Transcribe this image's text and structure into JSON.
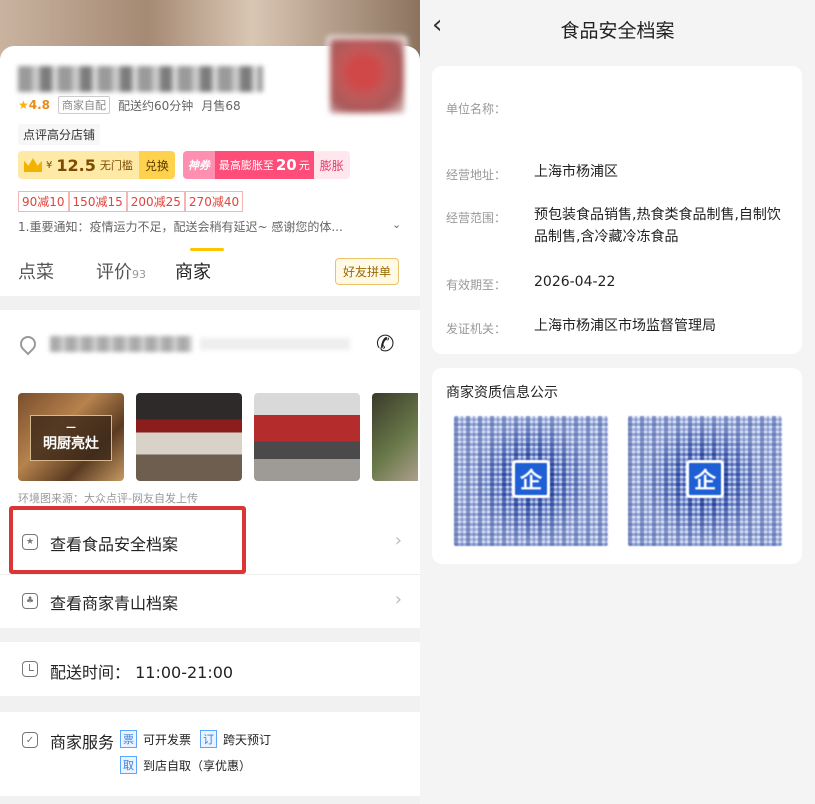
{
  "left": {
    "store": {
      "rating": "4.8",
      "delivery_type": "商家自配",
      "delivery_eta": "配送约60分钟",
      "monthly_sales": "月售68",
      "top_tag": "点评高分店铺"
    },
    "coupon": {
      "currency": "¥",
      "amount": "12.5",
      "condition": "无门槛",
      "redeem_label": "兑换",
      "hot_label": "神券",
      "boost_prefix": "最高膨胀至",
      "boost_amount": "20",
      "boost_unit": "元",
      "boost_button": "膨胀"
    },
    "discounts": [
      "90减10",
      "150减15",
      "200减25",
      "270减40"
    ],
    "notice": "1.重要通知：疫情运力不足，配送会稍有延迟~ 感谢您的体...",
    "tabs": {
      "dishes": "点菜",
      "reviews": "评价",
      "reviews_count": "93",
      "merchant": "商家"
    },
    "friend_button": "好友拼单",
    "photo_label": "明厨亮灶",
    "photo_source": "环境图来源：大众点评-网友自发上传",
    "links": {
      "food_safety": "查看食品安全档案",
      "qingshan": "查看商家青山档案"
    },
    "delivery_time": "配送时间：  11:00-21:00",
    "services": {
      "title": "商家服务",
      "invoice_tag": "票",
      "invoice": "可开发票",
      "reserve_tag": "订",
      "reserve": "跨天预订",
      "pickup_tag": "取",
      "pickup": "到店自取（享优惠）"
    }
  },
  "right": {
    "title": "食品安全档案",
    "license": {
      "name_label": "单位名称：",
      "name_value": "",
      "address_label": "经营地址：",
      "address_value": "上海市杨浦区",
      "scope_label": "经营范围：",
      "scope_value": "预包装食品销售,热食类食品制售,自制饮品制售,含冷藏冷冻食品",
      "expiry_label": "有效期至：",
      "expiry_value": "2026-04-22",
      "issuer_label": "发证机关：",
      "issuer_value": "上海市杨浦区市场监督管理局"
    },
    "qualification": {
      "title": "商家资质信息公示",
      "badge": "企"
    }
  },
  "colors": {
    "accent_yellow": "#ffc300",
    "highlight_red": "#d93636",
    "discount_red": "#e0443c",
    "badge_blue": "#1f5fd6"
  }
}
